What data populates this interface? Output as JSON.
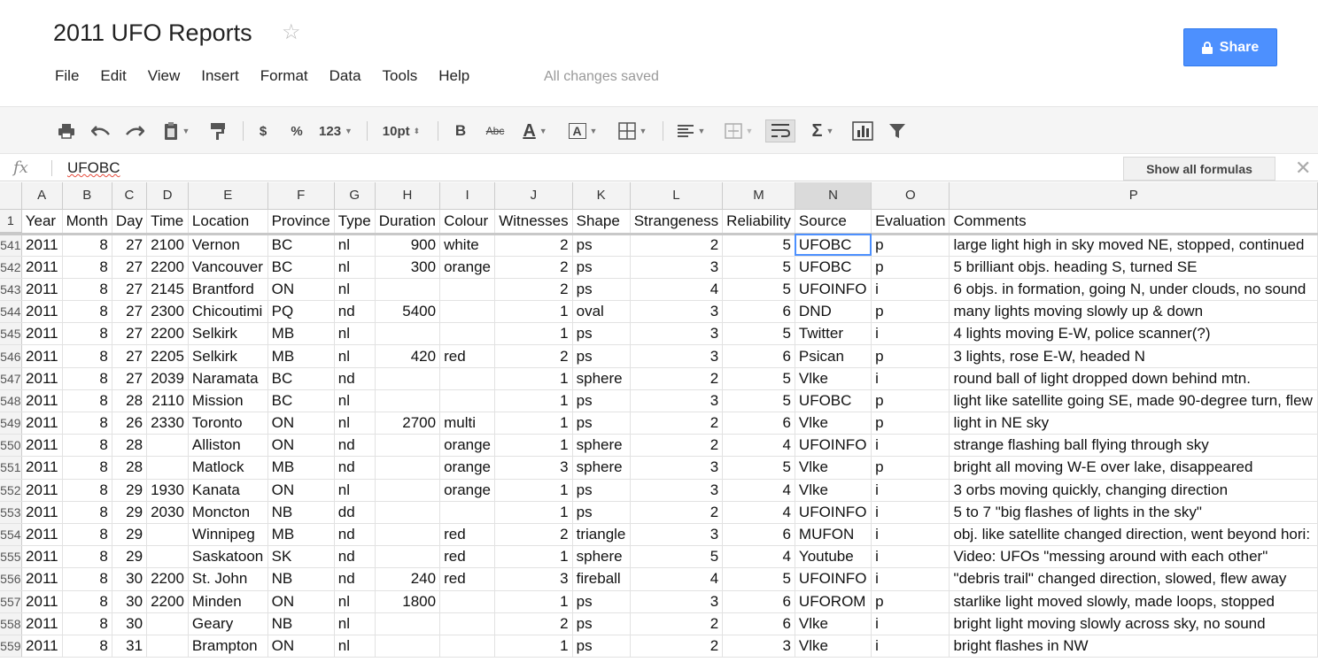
{
  "doc": {
    "title": "2011 UFO Reports",
    "saved_status": "All changes saved",
    "share_label": "Share"
  },
  "menu": [
    "File",
    "Edit",
    "View",
    "Insert",
    "Format",
    "Data",
    "Tools",
    "Help"
  ],
  "toolbar": {
    "currency": "$",
    "percent": "%",
    "number_format": "123",
    "font_size": "10pt",
    "bold": "B",
    "strikethrough": "Abc",
    "text_color": "A",
    "fill_color": "A",
    "sum": "Σ"
  },
  "formula": {
    "fx": "fx",
    "value": "UFOBC",
    "show_all": "Show all formulas"
  },
  "columns": [
    "A",
    "B",
    "C",
    "D",
    "E",
    "F",
    "G",
    "H",
    "I",
    "J",
    "K",
    "L",
    "M",
    "N",
    "O",
    "P"
  ],
  "header_row": {
    "num": "1",
    "cells": [
      "Year",
      "Month",
      "Day",
      "Time",
      "Location",
      "Province",
      "Type",
      "Duration",
      "Colour",
      "Witnesses",
      "Shape",
      "Strangeness",
      "Reliability",
      "Source",
      "Evaluation",
      "Comments"
    ]
  },
  "selected_column": "N",
  "active_cell": {
    "row": "541",
    "col": "N"
  },
  "rows": [
    {
      "num": "541",
      "cells": [
        "2011",
        "8",
        "27",
        "2100",
        "Vernon",
        "BC",
        "nl",
        "900",
        "white",
        "2",
        "ps",
        "2",
        "5",
        "UFOBC",
        "p",
        "large light high in sky moved NE, stopped, continued"
      ]
    },
    {
      "num": "542",
      "cells": [
        "2011",
        "8",
        "27",
        "2200",
        "Vancouver",
        "BC",
        "nl",
        "300",
        "orange",
        "2",
        "ps",
        "3",
        "5",
        "UFOBC",
        "p",
        "5 brilliant objs. heading S, turned SE"
      ]
    },
    {
      "num": "543",
      "cells": [
        "2011",
        "8",
        "27",
        "2145",
        "Brantford",
        "ON",
        "nl",
        "",
        "",
        "2",
        "ps",
        "4",
        "5",
        "UFOINFO",
        "i",
        "6 objs. in formation, going N, under clouds, no sound"
      ]
    },
    {
      "num": "544",
      "cells": [
        "2011",
        "8",
        "27",
        "2300",
        "Chicoutimi",
        "PQ",
        "nd",
        "5400",
        "",
        "1",
        "oval",
        "3",
        "6",
        "DND",
        "p",
        "many lights moving slowly up & down"
      ]
    },
    {
      "num": "545",
      "cells": [
        "2011",
        "8",
        "27",
        "2200",
        "Selkirk",
        "MB",
        "nl",
        "",
        "",
        "1",
        "ps",
        "3",
        "5",
        "Twitter",
        "i",
        "4 lights moving E-W, police scanner(?)"
      ]
    },
    {
      "num": "546",
      "cells": [
        "2011",
        "8",
        "27",
        "2205",
        "Selkirk",
        "MB",
        "nl",
        "420",
        "red",
        "2",
        "ps",
        "3",
        "6",
        "Psican",
        "p",
        "3 lights, rose E-W, headed N"
      ]
    },
    {
      "num": "547",
      "cells": [
        "2011",
        "8",
        "27",
        "2039",
        "Naramata",
        "BC",
        "nd",
        "",
        "",
        "1",
        "sphere",
        "2",
        "5",
        "Vlke",
        "i",
        "round ball of light dropped down behind mtn."
      ]
    },
    {
      "num": "548",
      "cells": [
        "2011",
        "8",
        "28",
        "2110",
        "Mission",
        "BC",
        "nl",
        "",
        "",
        "1",
        "ps",
        "3",
        "5",
        "UFOBC",
        "p",
        "light like satellite going SE, made 90-degree turn, flew"
      ]
    },
    {
      "num": "549",
      "cells": [
        "2011",
        "8",
        "26",
        "2330",
        "Toronto",
        "ON",
        "nl",
        "2700",
        "multi",
        "1",
        "ps",
        "2",
        "6",
        "Vlke",
        "p",
        "light in NE sky"
      ]
    },
    {
      "num": "550",
      "cells": [
        "2011",
        "8",
        "28",
        "",
        "Alliston",
        "ON",
        "nd",
        "",
        "orange",
        "1",
        "sphere",
        "2",
        "4",
        "UFOINFO",
        "i",
        "strange flashing ball flying through sky"
      ]
    },
    {
      "num": "551",
      "cells": [
        "2011",
        "8",
        "28",
        "",
        "Matlock",
        "MB",
        "nd",
        "",
        "orange",
        "3",
        "sphere",
        "3",
        "5",
        "Vlke",
        "p",
        "bright all moving W-E over lake, disappeared"
      ]
    },
    {
      "num": "552",
      "cells": [
        "2011",
        "8",
        "29",
        "1930",
        "Kanata",
        "ON",
        "nl",
        "",
        "orange",
        "1",
        "ps",
        "3",
        "4",
        "Vlke",
        "i",
        "3 orbs moving quickly, changing direction"
      ]
    },
    {
      "num": "553",
      "cells": [
        "2011",
        "8",
        "29",
        "2030",
        "Moncton",
        "NB",
        "dd",
        "",
        "",
        "1",
        "ps",
        "2",
        "4",
        "UFOINFO",
        "i",
        "5 to 7 \"big flashes of lights in the sky\""
      ]
    },
    {
      "num": "554",
      "cells": [
        "2011",
        "8",
        "29",
        "",
        "Winnipeg",
        "MB",
        "nd",
        "",
        "red",
        "2",
        "triangle",
        "3",
        "6",
        "MUFON",
        "i",
        "obj. like satellite changed direction, went beyond hori:"
      ]
    },
    {
      "num": "555",
      "cells": [
        "2011",
        "8",
        "29",
        "",
        "Saskatoon",
        "SK",
        "nd",
        "",
        "red",
        "1",
        "sphere",
        "5",
        "4",
        "Youtube",
        "i",
        "Video: UFOs \"messing around with each other\""
      ]
    },
    {
      "num": "556",
      "cells": [
        "2011",
        "8",
        "30",
        "2200",
        "St. John",
        "NB",
        "nd",
        "240",
        "red",
        "3",
        "fireball",
        "4",
        "5",
        "UFOINFO",
        "i",
        "\"debris trail\" changed direction, slowed, flew away"
      ]
    },
    {
      "num": "557",
      "cells": [
        "2011",
        "8",
        "30",
        "2200",
        "Minden",
        "ON",
        "nl",
        "1800",
        "",
        "1",
        "ps",
        "3",
        "6",
        "UFOROM",
        "p",
        "starlike light moved slowly, made loops, stopped"
      ]
    },
    {
      "num": "558",
      "cells": [
        "2011",
        "8",
        "30",
        "",
        "Geary",
        "NB",
        "nl",
        "",
        "",
        "2",
        "ps",
        "2",
        "6",
        "Vlke",
        "i",
        "bright light moving slowly across sky, no sound"
      ]
    },
    {
      "num": "559",
      "cells": [
        "2011",
        "8",
        "31",
        "",
        "Brampton",
        "ON",
        "nl",
        "",
        "",
        "1",
        "ps",
        "2",
        "3",
        "Vlke",
        "i",
        "bright flashes in NW"
      ]
    }
  ]
}
